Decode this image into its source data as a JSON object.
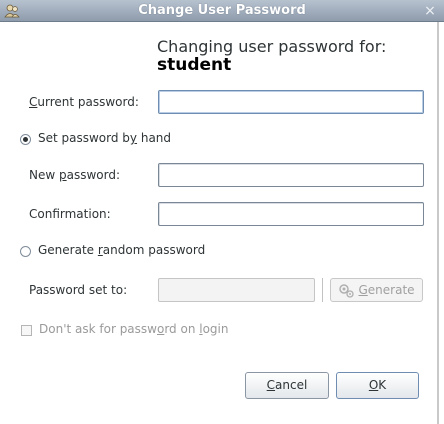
{
  "window": {
    "title": "Change User Password",
    "close_symbol": "×"
  },
  "header": {
    "line1": "Changing user password for:",
    "username": "student"
  },
  "current_password": {
    "label_pre": "",
    "label_mnemonic": "C",
    "label_post": "urrent password:",
    "value": ""
  },
  "set_by_hand": {
    "label_pre": "Set password b",
    "label_mnemonic": "y",
    "label_post": " hand",
    "selected": true
  },
  "new_password": {
    "label_pre": "New ",
    "label_mnemonic": "p",
    "label_post": "assword:",
    "value": ""
  },
  "confirmation": {
    "label_pre": "Conf",
    "label_mnemonic": "i",
    "label_post": "rmation:",
    "value": ""
  },
  "generate_random": {
    "label_pre": "Generate ",
    "label_mnemonic": "r",
    "label_post": "andom password",
    "selected": false
  },
  "password_set_to": {
    "label": "Password set to:",
    "value": ""
  },
  "generate_button": {
    "label_pre": "",
    "label_mnemonic": "G",
    "label_post": "enerate",
    "icon": "generate-icon"
  },
  "dont_ask": {
    "label_pre": "Don't ask for passw",
    "label_mnemonic": "o",
    "label_post": "rd on ",
    "label_mnemonic2": "l",
    "label_post2": "ogin",
    "checked": false
  },
  "buttons": {
    "cancel_pre": "",
    "cancel_mnemonic": "C",
    "cancel_post": "ancel",
    "ok_pre": "",
    "ok_mnemonic": "O",
    "ok_post": "K"
  },
  "colors": {
    "titlebar_start": "#b7c2cf",
    "titlebar_end": "#8e9bac",
    "focus_border": "#6f8db1"
  }
}
